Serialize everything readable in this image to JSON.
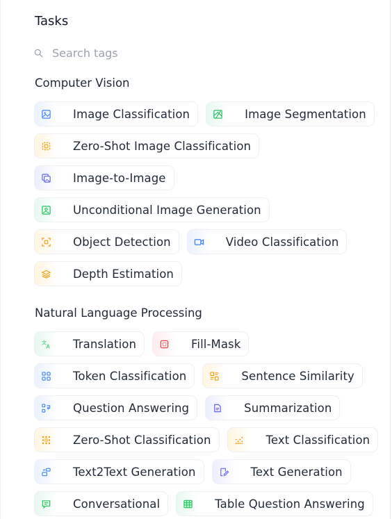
{
  "panel": {
    "title": "Tasks",
    "search_placeholder": "Search tags"
  },
  "sections": {
    "cv": {
      "title": "Computer Vision",
      "tags": [
        {
          "label": "Image Classification",
          "icon": "image-classification-icon",
          "color": "#3b82f6"
        },
        {
          "label": "Image Segmentation",
          "icon": "image-segmentation-icon",
          "color": "#22c55e"
        },
        {
          "label": "Zero-Shot Image Classification",
          "icon": "zero-shot-image-icon",
          "color": "#f59e0b"
        },
        {
          "label": "Image-to-Image",
          "icon": "image-to-image-icon",
          "color": "#6366f1"
        },
        {
          "label": "Unconditional Image Generation",
          "icon": "image-generation-icon",
          "color": "#22c55e"
        },
        {
          "label": "Object Detection",
          "icon": "object-detection-icon",
          "color": "#f59e0b"
        },
        {
          "label": "Video Classification",
          "icon": "video-classification-icon",
          "color": "#3b82f6"
        },
        {
          "label": "Depth Estimation",
          "icon": "depth-estimation-icon",
          "color": "#f59e0b"
        }
      ]
    },
    "nlp": {
      "title": "Natural Language Processing",
      "tags": [
        {
          "label": "Translation",
          "icon": "translation-icon",
          "color": "#22c55e"
        },
        {
          "label": "Fill-Mask",
          "icon": "fill-mask-icon",
          "color": "#ef4444"
        },
        {
          "label": "Token Classification",
          "icon": "token-classification-icon",
          "color": "#3b82f6"
        },
        {
          "label": "Sentence Similarity",
          "icon": "sentence-similarity-icon",
          "color": "#f59e0b"
        },
        {
          "label": "Question Answering",
          "icon": "question-answering-icon",
          "color": "#3b82f6"
        },
        {
          "label": "Summarization",
          "icon": "summarization-icon",
          "color": "#6366f1"
        },
        {
          "label": "Zero-Shot Classification",
          "icon": "zero-shot-classification-icon",
          "color": "#f59e0b"
        },
        {
          "label": "Text Classification",
          "icon": "text-classification-icon",
          "color": "#f59e0b"
        },
        {
          "label": "Text2Text Generation",
          "icon": "text2text-generation-icon",
          "color": "#3b82f6"
        },
        {
          "label": "Text Generation",
          "icon": "text-generation-icon",
          "color": "#6366f1"
        },
        {
          "label": "Conversational",
          "icon": "conversational-icon",
          "color": "#22c55e"
        },
        {
          "label": "Table Question Answering",
          "icon": "table-question-answering-icon",
          "color": "#22c55e"
        }
      ]
    }
  }
}
